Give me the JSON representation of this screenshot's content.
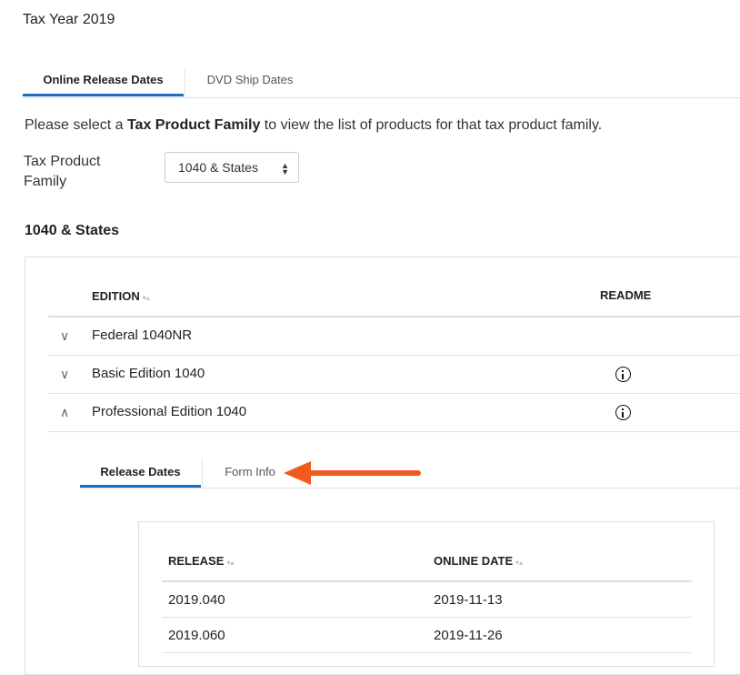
{
  "page_title": "Tax Year 2019",
  "top_tabs": [
    {
      "label": "Online Release Dates",
      "active": true
    },
    {
      "label": "DVD Ship Dates",
      "active": false
    }
  ],
  "instruction": {
    "prefix": "Please select a ",
    "bold": "Tax Product Family",
    "suffix": " to view the list of products for that tax product family."
  },
  "family_selector": {
    "label": "Tax Product Family",
    "selected": "1040 & States"
  },
  "section_heading": "1040 & States",
  "editions_table": {
    "columns": [
      "EDITION",
      "README"
    ],
    "rows": [
      {
        "name": "Federal 1040NR",
        "expanded": false,
        "readme": false
      },
      {
        "name": "Basic Edition 1040",
        "expanded": false,
        "readme": true
      },
      {
        "name": "Professional Edition 1040",
        "expanded": true,
        "readme": true
      }
    ]
  },
  "sub_tabs": [
    {
      "label": "Release Dates",
      "active": true
    },
    {
      "label": "Form Info",
      "active": false
    }
  ],
  "release_table": {
    "columns": [
      "RELEASE",
      "ONLINE DATE"
    ],
    "rows": [
      {
        "release": "2019.040",
        "online_date": "2019-11-13"
      },
      {
        "release": "2019.060",
        "online_date": "2019-11-26"
      }
    ]
  },
  "colors": {
    "accent": "#1a6fbf",
    "annotation_arrow": "#f05a1e"
  }
}
